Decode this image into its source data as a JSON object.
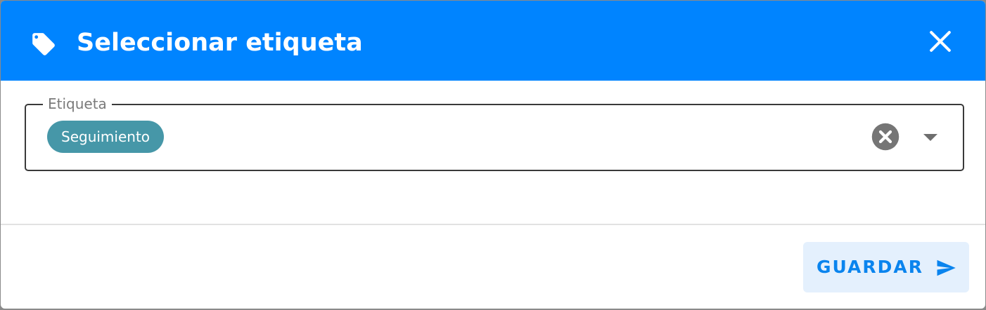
{
  "dialog": {
    "title": "Seleccionar etiqueta",
    "title_icon": "tag-icon",
    "close_icon": "close-icon"
  },
  "field": {
    "label": "Etiqueta",
    "selected_chip": "Seguimiento",
    "clear_icon": "clear-circle-icon",
    "dropdown_icon": "dropdown-arrow-icon"
  },
  "footer": {
    "save_label": "GUARDAR",
    "save_icon": "send-icon"
  },
  "colors": {
    "header_bg": "#0084ff",
    "chip_bg": "#4697a8",
    "accent": "#0a84ee",
    "save_bg": "#e4f0fd"
  }
}
